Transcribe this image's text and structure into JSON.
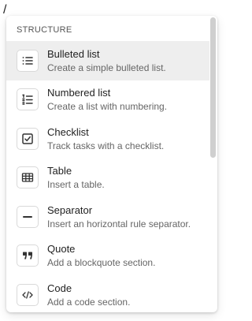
{
  "editor": {
    "typed_text": "/"
  },
  "menu": {
    "section_title": "STRUCTURE",
    "items": [
      {
        "label": "Bulleted list",
        "description": "Create a simple bulleted list.",
        "icon": "bulleted-list-icon",
        "active": true
      },
      {
        "label": "Numbered list",
        "description": "Create a list with numbering.",
        "icon": "numbered-list-icon",
        "active": false
      },
      {
        "label": "Checklist",
        "description": "Track tasks with a checklist.",
        "icon": "checkbox-icon",
        "active": false
      },
      {
        "label": "Table",
        "description": "Insert a table.",
        "icon": "table-icon",
        "active": false
      },
      {
        "label": "Separator",
        "description": "Insert an horizontal rule separator.",
        "icon": "separator-icon",
        "active": false
      },
      {
        "label": "Quote",
        "description": "Add a blockquote section.",
        "icon": "quote-icon",
        "active": false
      },
      {
        "label": "Code",
        "description": "Add a code section.",
        "icon": "code-icon",
        "active": false
      }
    ]
  },
  "colors": {
    "active_row": "#eeeeee",
    "icon_stroke": "#333333",
    "scrollbar": "#cfcfcf"
  }
}
